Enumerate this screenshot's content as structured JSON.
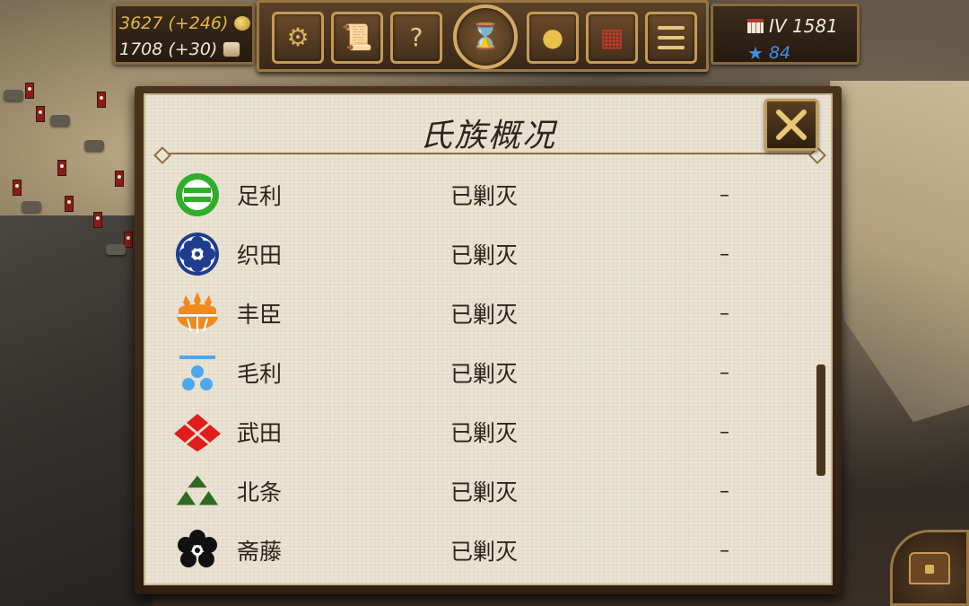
{
  "resources": {
    "gold": "3627 (+246)",
    "food": "1708 (+30)"
  },
  "menu": {
    "buttons": [
      {
        "name": "army-menu-button",
        "icon": "cannon-icon"
      },
      {
        "name": "policy-menu-button",
        "icon": "scroll-icon"
      },
      {
        "name": "quest-menu-button",
        "icon": "book-icon"
      },
      {
        "name": "calendar-menu-button",
        "icon": "calendar-hourglass-icon"
      },
      {
        "name": "treasury-menu-button",
        "icon": "gold-chest-icon"
      },
      {
        "name": "market-menu-button",
        "icon": "shop-icon"
      },
      {
        "name": "main-menu-button",
        "icon": "menu-lines-icon"
      }
    ]
  },
  "date": {
    "season_year": "IV 1581",
    "stars": "84"
  },
  "dialog": {
    "title": "氏族概况",
    "clans": [
      {
        "name": "足利",
        "status": "已剿灭",
        "value": "–",
        "crest": "ashikaga-crest",
        "color": "#2fae2c"
      },
      {
        "name": "织田",
        "status": "已剿灭",
        "value": "–",
        "crest": "oda-crest",
        "color": "#1e3d8f"
      },
      {
        "name": "丰臣",
        "status": "已剿灭",
        "value": "–",
        "crest": "toyotomi-crest",
        "color": "#f08a1c"
      },
      {
        "name": "毛利",
        "status": "已剿灭",
        "value": "–",
        "crest": "mori-crest",
        "color": "#4fa8ef"
      },
      {
        "name": "武田",
        "status": "已剿灭",
        "value": "–",
        "crest": "takeda-crest",
        "color": "#e21b1b"
      },
      {
        "name": "北条",
        "status": "已剿灭",
        "value": "–",
        "crest": "hojo-crest",
        "color": "#2f6a22"
      },
      {
        "name": "斋藤",
        "status": "已剿灭",
        "value": "–",
        "crest": "saito-crest",
        "color": "#111111"
      }
    ]
  }
}
